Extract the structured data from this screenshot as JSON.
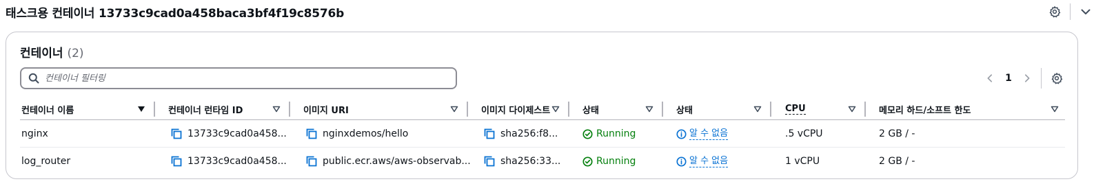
{
  "header": {
    "title": "태스크용 컨테이너 13733c9cad0a458baca3bf4f19c8576b"
  },
  "panel": {
    "title": "컨테이너",
    "count": "(2)",
    "search": {
      "placeholder": "컨테이너 필터링"
    },
    "pagination": {
      "current_page": "1"
    }
  },
  "table": {
    "columns": [
      {
        "label": "컨테이너 이름",
        "sort": "sorted-desc"
      },
      {
        "label": "컨테이너 런타임 ID",
        "sort": "sortable"
      },
      {
        "label": "이미지 URI",
        "sort": "sortable"
      },
      {
        "label": "이미지 다이제스트",
        "sort": "sortable"
      },
      {
        "label": "상태",
        "sort": "sortable"
      },
      {
        "label": "상태",
        "sort": "sortable"
      },
      {
        "label": "CPU",
        "sort": "sortable"
      },
      {
        "label": "메모리 하드/소프트 한도",
        "sort": "sortable"
      }
    ],
    "rows": [
      {
        "name": "nginx",
        "runtime_id": "13733c9cad0a458...",
        "image_uri": "nginxdemos/hello",
        "digest": "sha256:f8...",
        "status": "Running",
        "health": "알 수 없음",
        "cpu": ".5 vCPU",
        "memory": "2 GB / -"
      },
      {
        "name": "log_router",
        "runtime_id": "13733c9cad0a458...",
        "image_uri": "public.ecr.aws/aws-observab...",
        "digest": "sha256:33...",
        "status": "Running",
        "health": "알 수 없음",
        "cpu": "1 vCPU",
        "memory": "2 GB / -"
      }
    ]
  },
  "colors": {
    "text": "#0f141a",
    "muted": "#656871",
    "link": "#0972d3",
    "success": "#037f0c",
    "border": "#c6c6cd"
  },
  "icons": {
    "settings": "gear-icon",
    "collapse": "chevron-down-icon",
    "search": "search-icon",
    "copy": "copy-icon",
    "status_ok": "check-circle-icon",
    "info": "info-circle-icon"
  }
}
